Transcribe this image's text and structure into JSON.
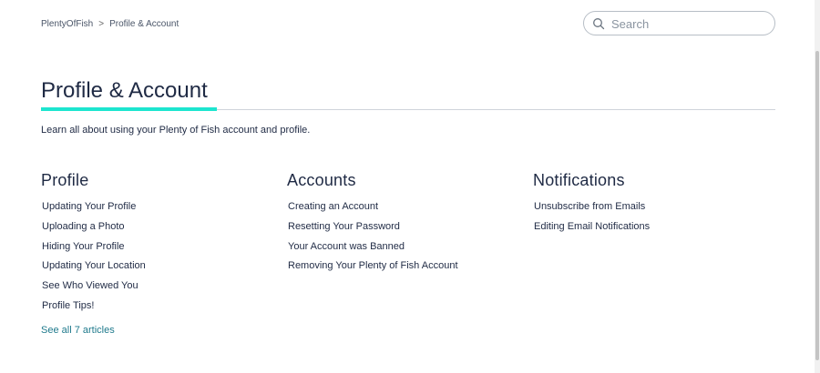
{
  "breadcrumb": {
    "home": "PlentyOfFish",
    "separator": ">",
    "current": "Profile & Account"
  },
  "search": {
    "placeholder": "Search",
    "value": "",
    "icon": "search-icon"
  },
  "page": {
    "title": "Profile & Account",
    "intro": "Learn all about using your Plenty of Fish account and profile."
  },
  "colors": {
    "accent": "#1de5cf",
    "text": "#1f2a44",
    "link": "#1f7a8c"
  },
  "sections": [
    {
      "heading": "Profile",
      "articles": [
        "Updating Your Profile",
        "Uploading a Photo",
        "Hiding Your Profile",
        "Updating Your Location",
        "See Who Viewed You",
        "Profile Tips!"
      ],
      "see_all": "See all 7 articles"
    },
    {
      "heading": "Accounts",
      "articles": [
        "Creating an Account",
        "Resetting Your Password",
        "Your Account was Banned",
        "Removing Your Plenty of Fish Account"
      ]
    },
    {
      "heading": "Notifications",
      "articles": [
        "Unsubscribe from Emails",
        "Editing Email Notifications"
      ]
    }
  ]
}
